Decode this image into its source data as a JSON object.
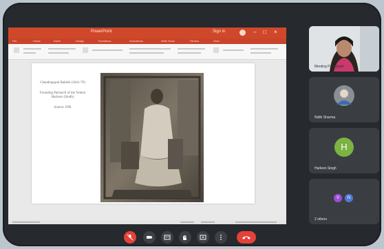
{
  "presentation": {
    "window_title": "PowerPoint",
    "user_label": "Sign in",
    "tabs": [
      "File",
      "Home",
      "Insert",
      "Design",
      "Transitions",
      "Animations",
      "Slide Show",
      "Review",
      "View"
    ],
    "slide_caption": [
      "Chandragopal Bakhsh (1841-79)",
      "Founding Patriarch of the Yemen Harbour (Sindh)",
      "Source: IOR"
    ]
  },
  "participants": [
    {
      "name": "Meeting Participant",
      "type": "video"
    },
    {
      "name": "Nidhi Sharma",
      "type": "avatar-photo"
    },
    {
      "name": "Harleen Singh",
      "type": "monogram",
      "initial": "H",
      "color": "#7cb342"
    },
    {
      "name": "2 others",
      "type": "group",
      "initials": [
        "V",
        "N"
      ],
      "colors": [
        "#9c4fd6",
        "#4f7ad6"
      ]
    }
  ],
  "controls": [
    {
      "name": "mic-off",
      "glyph": "🎙"
    },
    {
      "name": "camera",
      "glyph": "📷"
    },
    {
      "name": "captions",
      "glyph": "CC"
    },
    {
      "name": "raise-hand",
      "glyph": "✋"
    },
    {
      "name": "present",
      "glyph": "⇧"
    },
    {
      "name": "more",
      "glyph": "⋮"
    }
  ],
  "colors": {
    "ppt_accent": "#d0482a",
    "meet_bg": "#26292d",
    "end_call": "#e3423a"
  }
}
